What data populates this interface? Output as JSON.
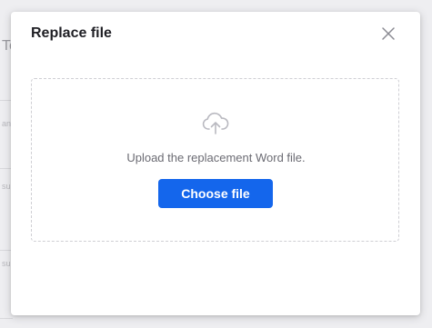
{
  "background": {
    "title_fragment": "Te",
    "row_fragments": [
      "an",
      "su",
      "su"
    ]
  },
  "modal": {
    "title": "Replace file",
    "close_icon": "close-icon",
    "dropzone": {
      "icon": "cloud-upload-icon",
      "text": "Upload the replacement Word file.",
      "button_label": "Choose file"
    }
  },
  "colors": {
    "accent": "#1466ec",
    "title": "#1f1f24",
    "muted_text": "#6b6b73",
    "border": "#cfcfd4"
  }
}
